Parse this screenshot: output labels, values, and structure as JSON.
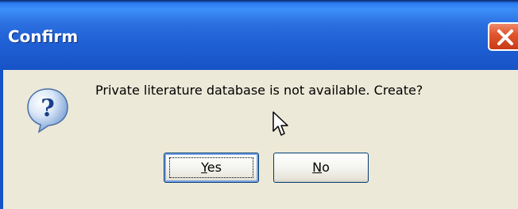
{
  "window": {
    "title": "Confirm"
  },
  "dialog": {
    "message": "Private literature database is not available. Create?",
    "icon": "question-icon",
    "buttons": {
      "yes_label_accel": "Y",
      "yes_label_rest": "es",
      "no_label_accel": "N",
      "no_label_rest": "o"
    }
  },
  "colors": {
    "titlebar": "#1f5fd4",
    "close_button": "#e1562e",
    "dialog_background": "#ece9d8"
  }
}
